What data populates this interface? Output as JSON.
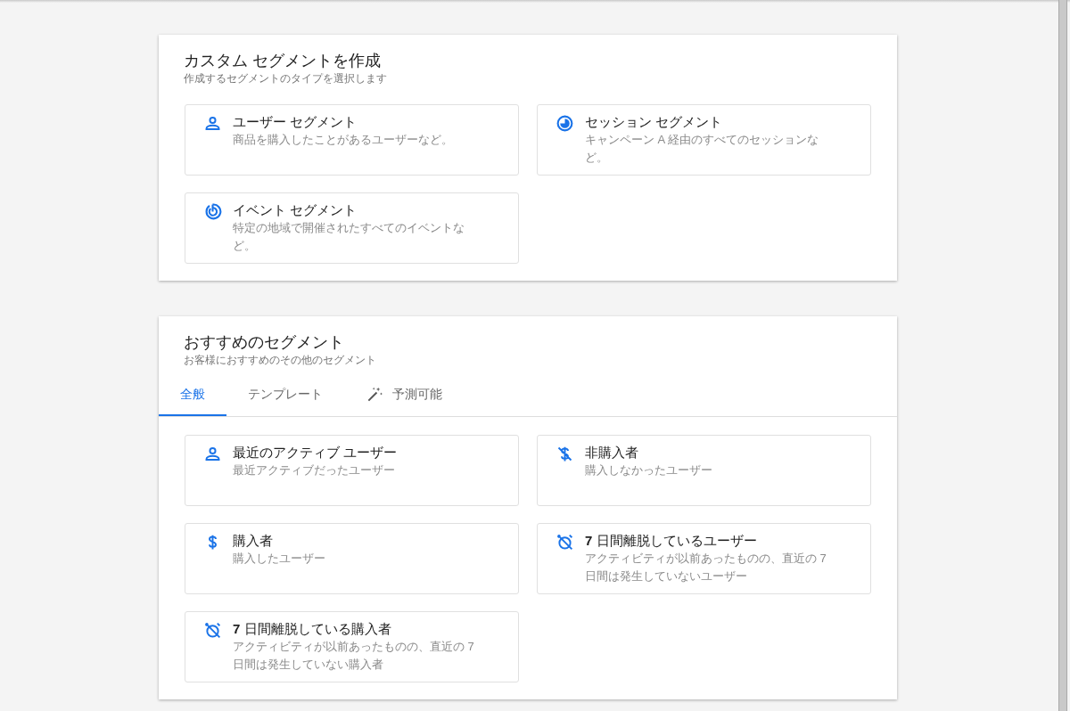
{
  "create_panel": {
    "title": "カスタム セグメントを作成",
    "subtitle": "作成するセグメントのタイプを選択します",
    "options": [
      {
        "kind": "user",
        "title": "ユーザー セグメント",
        "description": "商品を購入したことがあるユーザーなど。"
      },
      {
        "kind": "session",
        "title": "セッション セグメント",
        "description": "キャンペーン A 経由のすべてのセッションなど。"
      },
      {
        "kind": "event",
        "title": "イベント セグメント",
        "description": "特定の地域で開催されたすべてのイベントなど。"
      }
    ]
  },
  "suggested_panel": {
    "title": "おすすめのセグメント",
    "subtitle": "お客様におすすめのその他のセグメント",
    "tabs": [
      {
        "label": "全般",
        "selected": true
      },
      {
        "label": "テンプレート",
        "selected": false
      },
      {
        "label": "予測可能",
        "selected": false,
        "kind": "predictive"
      }
    ],
    "options": [
      {
        "kind": "user",
        "title": "最近のアクティブ ユーザー",
        "description": "最近アクティブだったユーザー"
      },
      {
        "kind": "no-dollar",
        "title": "非購入者",
        "description": "購入しなかったユーザー"
      },
      {
        "kind": "dollar",
        "title": "購入者",
        "description": "購入したユーザー"
      },
      {
        "kind": "alarm-off",
        "title": "**7** 日間離脱しているユーザー",
        "description": "アクティビティが以前あったものの、直近の 7 日間は発生していないユーザー"
      },
      {
        "kind": "alarm-off",
        "title": "**7** 日間離脱している購入者",
        "description": "アクティビティが以前あったものの、直近の 7 日間は発生していない購入者"
      }
    ]
  }
}
